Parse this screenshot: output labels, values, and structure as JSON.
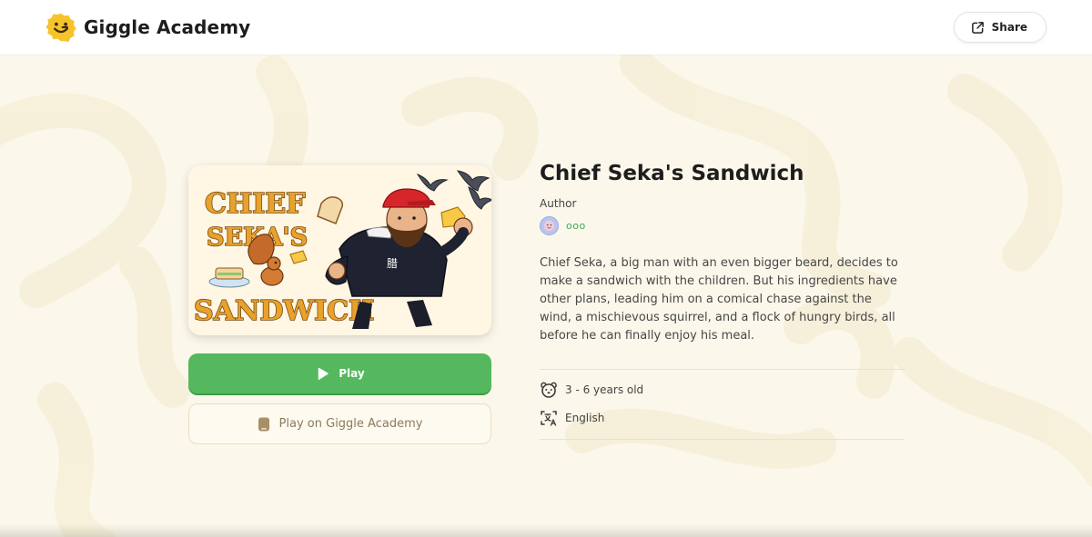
{
  "header": {
    "brand_name": "Giggle Academy",
    "share_label": "Share",
    "logo_icon": "smiley-g-logo",
    "share_icon": "external-link-icon"
  },
  "book": {
    "title": "Chief Seka's Sandwich",
    "author_label": "Author",
    "author_name": "ooo",
    "description": "Chief Seka, a big man with an even bigger beard, decides to make a sandwich with the children. But his ingredients have other plans, leading him on a comical chase against the wind, a mischievous squirrel, and a flock of hungry birds, all before he can finally enjoy his meal.",
    "cover_title_lines": [
      "CHIEF",
      "SEKA'S",
      "SANDWICH"
    ],
    "age_range": "3 - 6 years old",
    "language": "English"
  },
  "actions": {
    "play_label": "Play",
    "play_academy_label": "Play on Giggle Academy"
  },
  "colors": {
    "brand_yellow": "#f6c32a",
    "play_green": "#55b85e",
    "author_green": "#3ea85b",
    "page_bg": "#fbf7ea"
  }
}
